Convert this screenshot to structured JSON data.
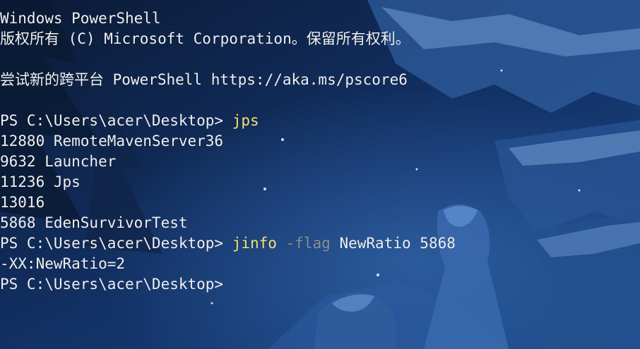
{
  "window": {
    "background_color": "#0d1f3c"
  },
  "terminal": {
    "text_color": "#f0f0f0",
    "command_color": "#f3e37a",
    "flag_color": "#8e9096",
    "banner_line1": "Windows PowerShell",
    "banner_line2": "版权所有 (C) Microsoft Corporation。保留所有权利。",
    "banner_line3": "尝试新的跨平台 PowerShell https://aka.ms/pscore6",
    "prompt1": "PS C:\\Users\\acer\\Desktop> ",
    "command1": "jps",
    "output1": [
      "12880 RemoteMavenServer36",
      "9632 Launcher",
      "11236 Jps",
      "13016",
      "5868 EdenSurvivorTest"
    ],
    "prompt2": "PS C:\\Users\\acer\\Desktop> ",
    "command2": {
      "name": "jinfo",
      "flag": "-flag",
      "arg1": "NewRatio",
      "arg2": "5868"
    },
    "output2": "-XX:NewRatio=2",
    "prompt3": "PS C:\\Users\\acer\\Desktop>"
  }
}
